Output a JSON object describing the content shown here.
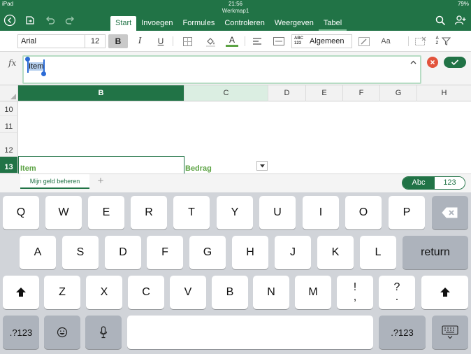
{
  "status_bar": {
    "device": "iPad",
    "time": "21:56",
    "battery": "79%"
  },
  "document": {
    "name": "Werkmap1"
  },
  "ribbon_tabs": [
    "Start",
    "Invoegen",
    "Formules",
    "Controleren",
    "Weergeven",
    "Tabel"
  ],
  "active_tab": "Start",
  "ribbon": {
    "font_name": "Arial",
    "font_size": "12",
    "bold_label": "B",
    "italic_label": "I",
    "underline_label": "U",
    "font_color_label": "A",
    "number_format_hint": "ABC 123",
    "number_format": "Algemeen",
    "cell_style_label": "Aa",
    "sort_hint": "A Z"
  },
  "formula_bar": {
    "fx_label": "fx",
    "value": "Item"
  },
  "grid": {
    "columns": [
      "B",
      "C",
      "D",
      "E",
      "F",
      "G",
      "H"
    ],
    "rows": [
      "10",
      "11",
      "12",
      "13"
    ],
    "cells": {
      "B13": "Item",
      "C13": "Bedrag"
    }
  },
  "sheets": {
    "tabs": [
      "Mijn geld beheren"
    ],
    "add_label": "+"
  },
  "keyboard_mode": {
    "letters": "Abc",
    "numbers": "123"
  },
  "keyboard": {
    "row1": [
      "Q",
      "W",
      "E",
      "R",
      "T",
      "Y",
      "U",
      "I",
      "O",
      "P"
    ],
    "row2": [
      "A",
      "S",
      "D",
      "F",
      "G",
      "H",
      "J",
      "K",
      "L"
    ],
    "row3": [
      "Z",
      "X",
      "C",
      "V",
      "B",
      "N",
      "M",
      "!",
      "?"
    ],
    "row3_sub": [
      ",",
      "."
    ],
    "return_label": "return",
    "numbers_label": ".?123"
  },
  "colors": {
    "accent": "#217346",
    "cell_text": "#5ca344",
    "cancel": "#e2533c"
  }
}
